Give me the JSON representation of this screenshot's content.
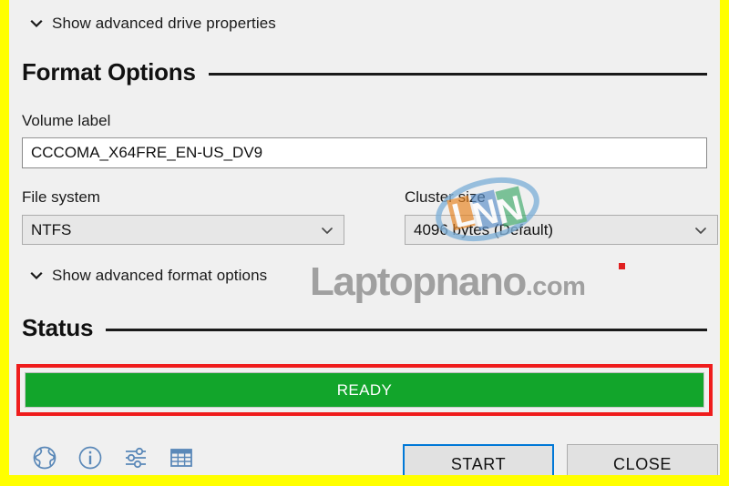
{
  "window": {
    "background_color": "#f0f0f0",
    "highlight_border_color": "#ffff00"
  },
  "drive_properties": {
    "expander_label": "Show advanced drive properties",
    "chevron_icon": "chevron-down-icon"
  },
  "format_options": {
    "heading": "Format Options",
    "volume_label_caption": "Volume label",
    "volume_label_value": "CCCOMA_X64FRE_EN-US_DV9",
    "file_system_caption": "File system",
    "file_system_value": "NTFS",
    "cluster_size_caption": "Cluster size",
    "cluster_size_value": "4096 bytes (Default)",
    "expander_label": "Show advanced format options",
    "chevron_icon": "chevron-down-icon",
    "dropdown_icon": "chevron-down-icon"
  },
  "status": {
    "heading": "Status",
    "bar_text": "READY",
    "bar_color": "#12a52b",
    "highlight_color": "#ef1c1c"
  },
  "toolbar": {
    "icons": [
      {
        "name": "globe-icon",
        "title": "Language"
      },
      {
        "name": "info-icon",
        "title": "About"
      },
      {
        "name": "settings-sliders-icon",
        "title": "Settings"
      },
      {
        "name": "log-icon",
        "title": "Log"
      }
    ]
  },
  "actions": {
    "start_label": "START",
    "close_label": "CLOSE",
    "start_focus_color": "#0078d7"
  },
  "watermark": {
    "site_name": "Laptopnano",
    "site_tld": ".com",
    "logo_letters": [
      "L",
      "N",
      "N"
    ],
    "logo_colors": [
      "#e8821e",
      "#5b8fc9",
      "#3faa6b"
    ],
    "text_color": "#9a9a9a",
    "dot_color": "#e02020"
  }
}
